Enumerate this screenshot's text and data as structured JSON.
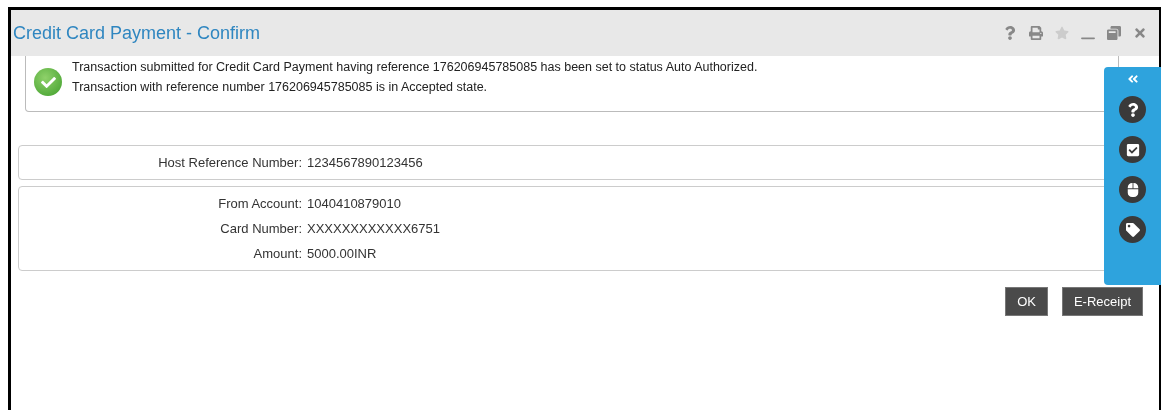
{
  "window": {
    "title": "Credit Card Payment - Confirm"
  },
  "message": {
    "lines": [
      "Transaction submitted for Credit Card Payment having reference 176206945785085 has been set to status Auto Authorized.",
      "Transaction with reference number 176206945785085 is in Accepted state."
    ]
  },
  "host_reference": {
    "label": "Host Reference Number:",
    "value": "1234567890123456"
  },
  "details": [
    {
      "label": "From Account:",
      "value": "1040410879010"
    },
    {
      "label": "Card Number:",
      "value": "XXXXXXXXXXXX6751"
    },
    {
      "label": "Amount:",
      "value": "5000.00INR"
    }
  ],
  "buttons": [
    "OK",
    "E-Receipt"
  ]
}
